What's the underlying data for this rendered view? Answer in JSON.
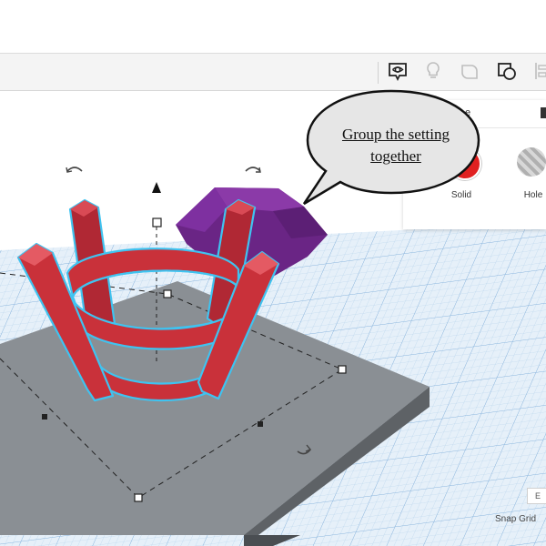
{
  "callout": {
    "text": "Group the setting together"
  },
  "shape_panel": {
    "title_partial": "e",
    "options": [
      {
        "label": "Solid",
        "color": "#e02020"
      },
      {
        "label": "Hole",
        "color": "#b0b0b0"
      }
    ]
  },
  "workplane": {
    "snap_grid_label": "Snap Grid",
    "edit_grid_label": "E"
  },
  "toolbar": {
    "icons": [
      "notes-icon",
      "lightbulb-icon",
      "shape-outline-icon",
      "group-icon",
      "align-icon"
    ]
  },
  "colors": {
    "setting_red": "#c9313a",
    "gem_purple": "#7b2d9a",
    "workplane_blue": "#dcebf7",
    "base_gray": "#8a8f94",
    "selection_outline": "#3fc3f0"
  }
}
